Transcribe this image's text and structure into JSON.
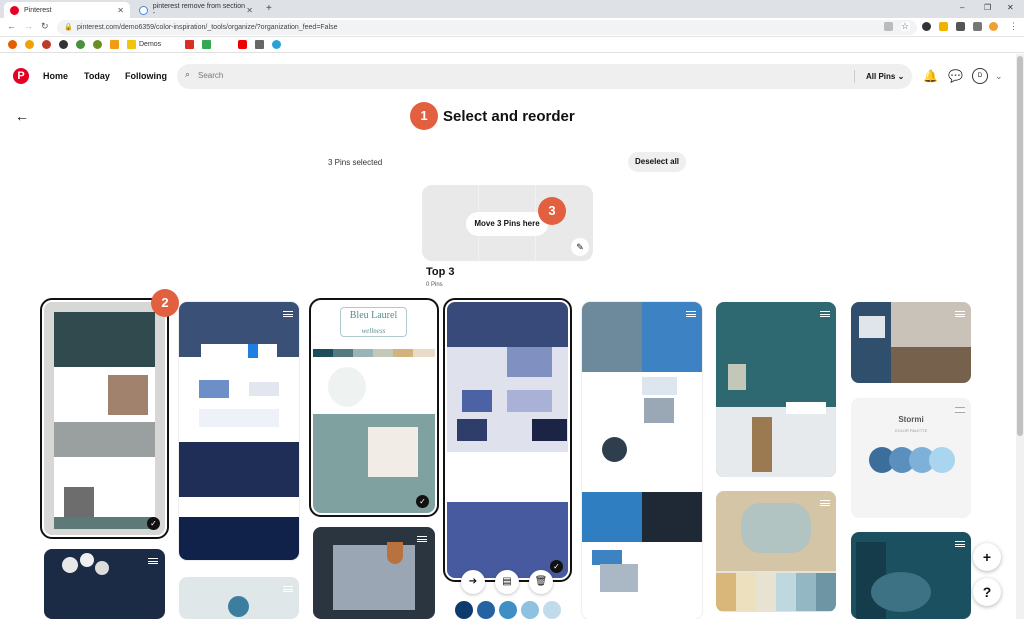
{
  "browser": {
    "tabs": [
      {
        "label": "Pinterest"
      },
      {
        "label": "pinterest remove from section -"
      }
    ],
    "url": "pinterest.com/demo6359/color-inspiration/_tools/organize/?organization_feed=False",
    "bookmarks_label": "Demos"
  },
  "header": {
    "nav": [
      "Home",
      "Today",
      "Following"
    ],
    "search_placeholder": "Search",
    "filter_label": "All Pins",
    "avatar_letter": "D"
  },
  "page": {
    "title": "Select and reorder",
    "selected_count": "3 Pins selected",
    "deselect_label": "Deselect all",
    "move_label": "Move 3 Pins here",
    "board_name": "Top 3",
    "board_pin_count": "0 Pins",
    "steps": [
      "1",
      "2",
      "3"
    ],
    "pin_text": {
      "logo_text": "Bleu Laurel",
      "logo_sub": "wellness",
      "stormi_title": "Stormi",
      "stormi_sub": "COLOR PALETTE"
    }
  },
  "colors": {
    "accent": "#e60023",
    "step": "#e2603f"
  }
}
